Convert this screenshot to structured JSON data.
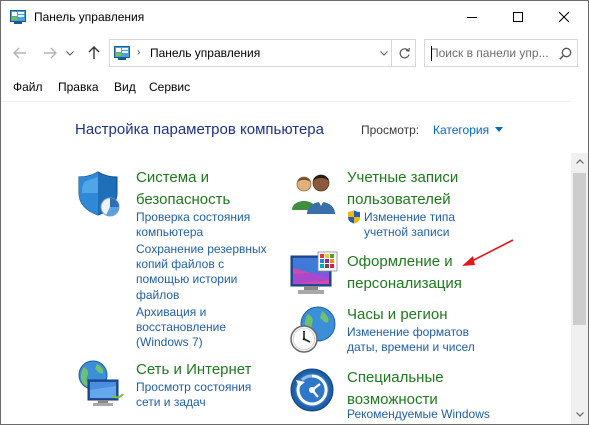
{
  "window": {
    "title": "Панель управления",
    "minimize_icon": "minimize-icon",
    "maximize_icon": "maximize-icon",
    "close_icon": "close-icon"
  },
  "nav": {
    "address": "Панель управления",
    "search_placeholder": "Поиск в панели упр..."
  },
  "menu": {
    "items": [
      "Файл",
      "Правка",
      "Вид",
      "Сервис"
    ]
  },
  "content": {
    "heading": "Настройка параметров компьютера",
    "view_label": "Просмотр:",
    "view_value": "Категория"
  },
  "categories": {
    "system": {
      "title_1": "Система и",
      "title_2": "безопасность",
      "links": [
        [
          "Проверка состояния",
          "компьютера"
        ],
        [
          "Сохранение резервных",
          "копий файлов с",
          "помощью истории",
          "файлов"
        ],
        [
          "Архивация и",
          "восстановление",
          "(Windows 7)"
        ]
      ]
    },
    "accounts": {
      "title_1": "Учетные записи",
      "title_2": "пользователей",
      "links": [
        [
          "Изменение типа",
          "учетной записи"
        ]
      ]
    },
    "appearance": {
      "title_1": "Оформление и",
      "title_2": "персонализация"
    },
    "clock": {
      "title": "Часы и регион",
      "links": [
        [
          "Изменение форматов",
          "даты, времени и чисел"
        ]
      ]
    },
    "network": {
      "title": "Сеть и Интернет",
      "links": [
        [
          "Просмотр состояния",
          "сети и задач"
        ]
      ]
    },
    "access": {
      "title_1": "Специальные",
      "title_2": "возможности",
      "links": [
        [
          "Рекомендуемые Windows"
        ]
      ]
    }
  },
  "colors": {
    "heading": "#1e3287",
    "category_title": "#1d7a1d",
    "link": "#1f5fa8",
    "annotation_arrow": "#e0191e"
  }
}
